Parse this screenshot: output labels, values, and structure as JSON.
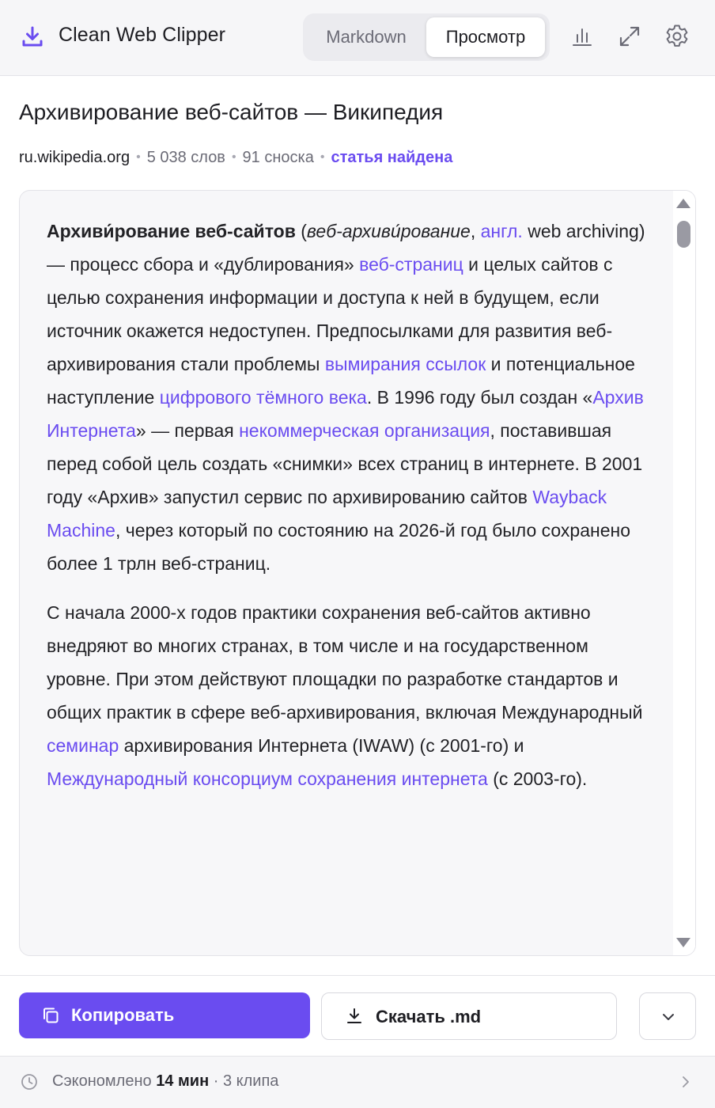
{
  "header": {
    "app_title": "Clean Web Clipper",
    "tabs": [
      {
        "label": "Markdown",
        "active": false
      },
      {
        "label": "Просмотр",
        "active": true
      }
    ],
    "icons": [
      "download-icon",
      "stats-icon",
      "expand-icon",
      "settings-icon"
    ]
  },
  "article": {
    "title": "Архивирование веб-сайтов — Википедия",
    "domain": "ru.wikipedia.org",
    "word_count": "5 038 слов",
    "footnotes": "91 сноска",
    "status": "статья найдена"
  },
  "preview": {
    "p1": {
      "bold": "Архиви́рование веб-сайтов",
      "t1": " (",
      "italic": "веб-архиви́рование",
      "t2": ", ",
      "l1": "англ.",
      "t3": " web archiving) — процесс сбора и «дублирования» ",
      "l2": "веб-страниц",
      "t4": " и целых сайтов с целью сохранения информации и доступа к ней в будущем, если источник окажется недоступен. Предпосылками для развития веб-архивирования стали проблемы ",
      "l3": "вымирания ссылок",
      "t5": " и потенциальное наступление ",
      "l4": "цифрового тёмного века",
      "t6": ". В 1996 году был создан «",
      "l5": "Архив Интернета",
      "t7": "» — первая ",
      "l6": "некоммерческая организация",
      "t8": ", поставившая перед собой цель создать «снимки» всех страниц в интернете. В 2001 году «Архив» запустил сервис по архивированию сайтов ",
      "l7": "Wayback Machine",
      "t9": ", через который по состоянию на 2026-й год было сохранено более 1 трлн веб-страниц."
    },
    "p2": {
      "t1": "С начала 2000-х годов практики сохранения веб-сайтов активно внедряют во многих странах, в том числе и на государственном уровне. При этом действуют площадки по разработке стандартов и общих практик в сфере веб-архивирования, включая Международный ",
      "l1": "семинар",
      "t2": " архивирования Интернета (IWAW) (с 2001-го) и ",
      "l2": "Международный консорциум сохранения интернета",
      "t3": " (с 2003-го)."
    }
  },
  "actions": {
    "copy_label": "Копировать",
    "download_label": "Скачать .md"
  },
  "footer": {
    "saved_prefix": "Сэкономлено",
    "saved_value": "14 мин",
    "clips": "· 3 клипа"
  },
  "colors": {
    "accent": "#6a4cf0",
    "link": "#6a4cf0",
    "text": "#1d1d22",
    "muted": "#6b6b76"
  }
}
